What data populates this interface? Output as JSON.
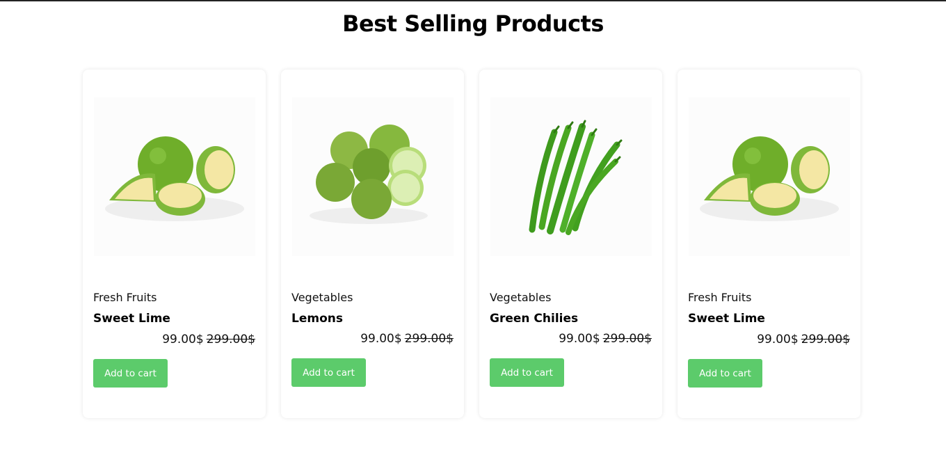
{
  "section": {
    "title": "Best Selling Products"
  },
  "products": [
    {
      "category": "Fresh Fruits",
      "name": "Sweet Lime",
      "price": "99.00$",
      "old_price": "299.00$",
      "button_label": "Add to cart",
      "image": "sweet-lime-image"
    },
    {
      "category": "Vegetables",
      "name": "Lemons",
      "price": "99.00$",
      "old_price": "299.00$",
      "button_label": "Add to cart",
      "image": "lemons-image"
    },
    {
      "category": "Vegetables",
      "name": "Green Chilies",
      "price": "99.00$",
      "old_price": "299.00$",
      "button_label": "Add to cart",
      "image": "green-chilies-image"
    },
    {
      "category": "Fresh Fruits",
      "name": "Sweet Lime",
      "price": "99.00$",
      "old_price": "299.00$",
      "button_label": "Add to cart",
      "image": "sweet-lime-image"
    }
  ],
  "colors": {
    "button": "#5ccb6b",
    "button_text": "#ffffff"
  }
}
